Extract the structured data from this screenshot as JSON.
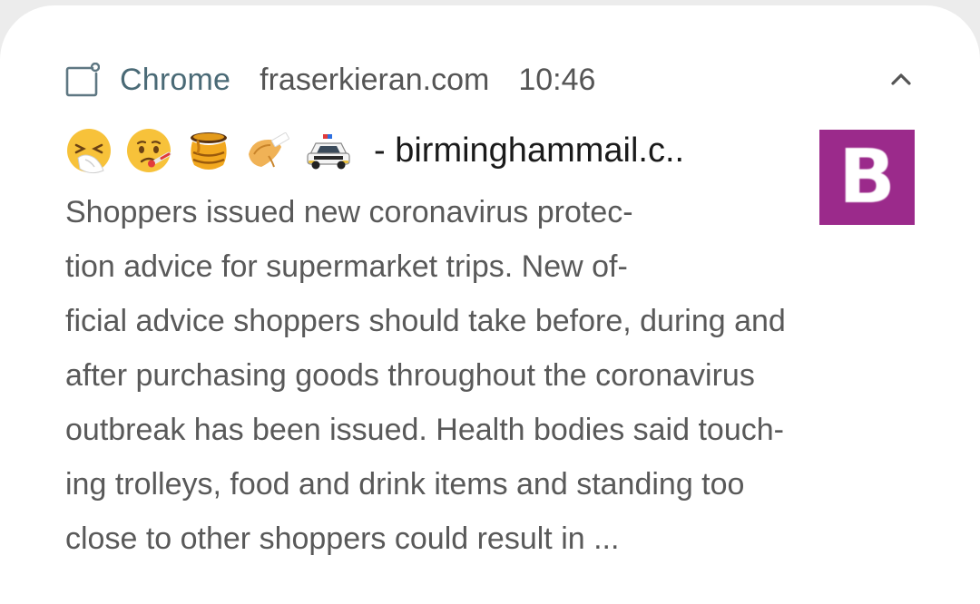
{
  "notification": {
    "app_name": "Chrome",
    "sender": "fraserkieran.com",
    "time": "10:46",
    "title": "- birminghammail.c..",
    "emojis": [
      "sneezing-face",
      "face-with-thermometer",
      "honey-pot",
      "fortune-cookie",
      "police-car"
    ],
    "avatar_letter": "B",
    "avatar_color": "#9b2a8b",
    "body_lines": [
      "Shoppers issued new coronavirus protec-",
      "tion advice for supermarket trips. New of-",
      "ficial advice shoppers should take before, during and",
      "after purchasing goods throughout the coronavirus",
      "outbreak has been issued. Health bodies said touch-",
      "ing trolleys, food and drink items and standing too",
      "close to other shoppers could result in ..."
    ]
  }
}
